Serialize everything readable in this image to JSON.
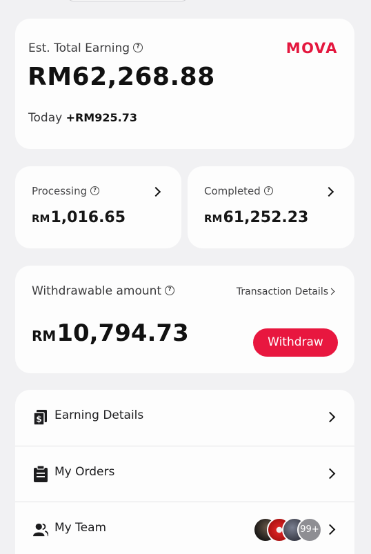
{
  "earnings": {
    "label": "Est. Total Earning",
    "brand": "MOVA",
    "total": "RM62,268.88",
    "today_label": "Today",
    "today_value": "+RM925.73"
  },
  "processing": {
    "label": "Processing",
    "currency": "RM",
    "amount": "1,016.65"
  },
  "completed": {
    "label": "Completed",
    "currency": "RM",
    "amount": "61,252.23"
  },
  "withdraw": {
    "label": "Withdrawable amount",
    "link": "Transaction Details",
    "currency": "RM",
    "amount": "10,794.73",
    "button": "Withdraw"
  },
  "menu": [
    {
      "label": "Earning Details",
      "icon": "dollar-note-icon"
    },
    {
      "label": "My Orders",
      "icon": "clipboard-icon"
    },
    {
      "label": "My Team",
      "icon": "team-icon",
      "badge": "99+"
    }
  ],
  "colors": {
    "accent": "#e8173f",
    "background": "#f1f1f3",
    "card": "#fdfdfd"
  }
}
